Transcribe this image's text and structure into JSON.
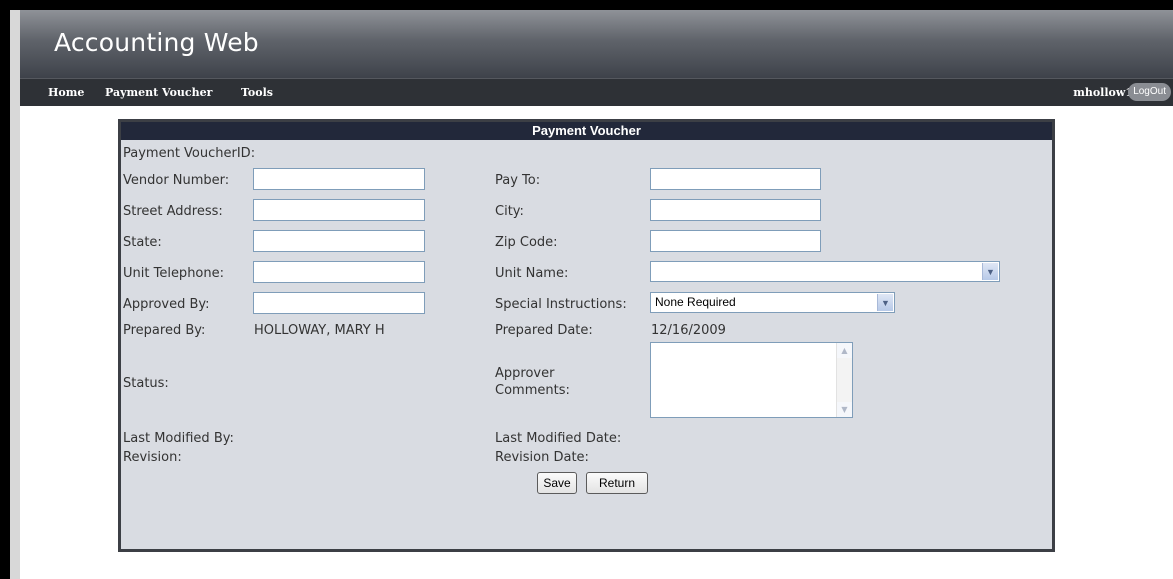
{
  "app": {
    "title": "Accounting Web"
  },
  "nav": {
    "home": "Home",
    "payment_voucher": "Payment Voucher",
    "tools": "Tools"
  },
  "user": {
    "name": "mhollow1",
    "logout": "LogOut"
  },
  "form": {
    "title": "Payment Voucher",
    "labels": {
      "voucher_id": "Payment VoucherID:",
      "vendor_number": "Vendor Number:",
      "street_address": "Street Address:",
      "state": "State:",
      "unit_telephone": "Unit Telephone:",
      "approved_by": "Approved By:",
      "prepared_by": "Prepared By:",
      "status": "Status:",
      "last_modified_by": "Last Modified By:",
      "revision": "Revision:",
      "pay_to": "Pay To:",
      "city": "City:",
      "zip_code": "Zip Code:",
      "unit_name": "Unit Name:",
      "special_instructions": "Special Instructions:",
      "prepared_date": "Prepared Date:",
      "approver_comments_1": "Approver",
      "approver_comments_2": "Comments:",
      "last_modified_date": "Last Modified Date:",
      "revision_date": "Revision Date:"
    },
    "values": {
      "prepared_by": "HOLLOWAY, MARY H",
      "prepared_date": "12/16/2009",
      "special_instructions": "None Required",
      "unit_name": ""
    },
    "buttons": {
      "save": "Save",
      "return": "Return"
    }
  },
  "icons": {
    "dropdown": "chevron-down-icon",
    "scroll_up": "scroll-up-icon",
    "scroll_down": "scroll-down-icon"
  }
}
